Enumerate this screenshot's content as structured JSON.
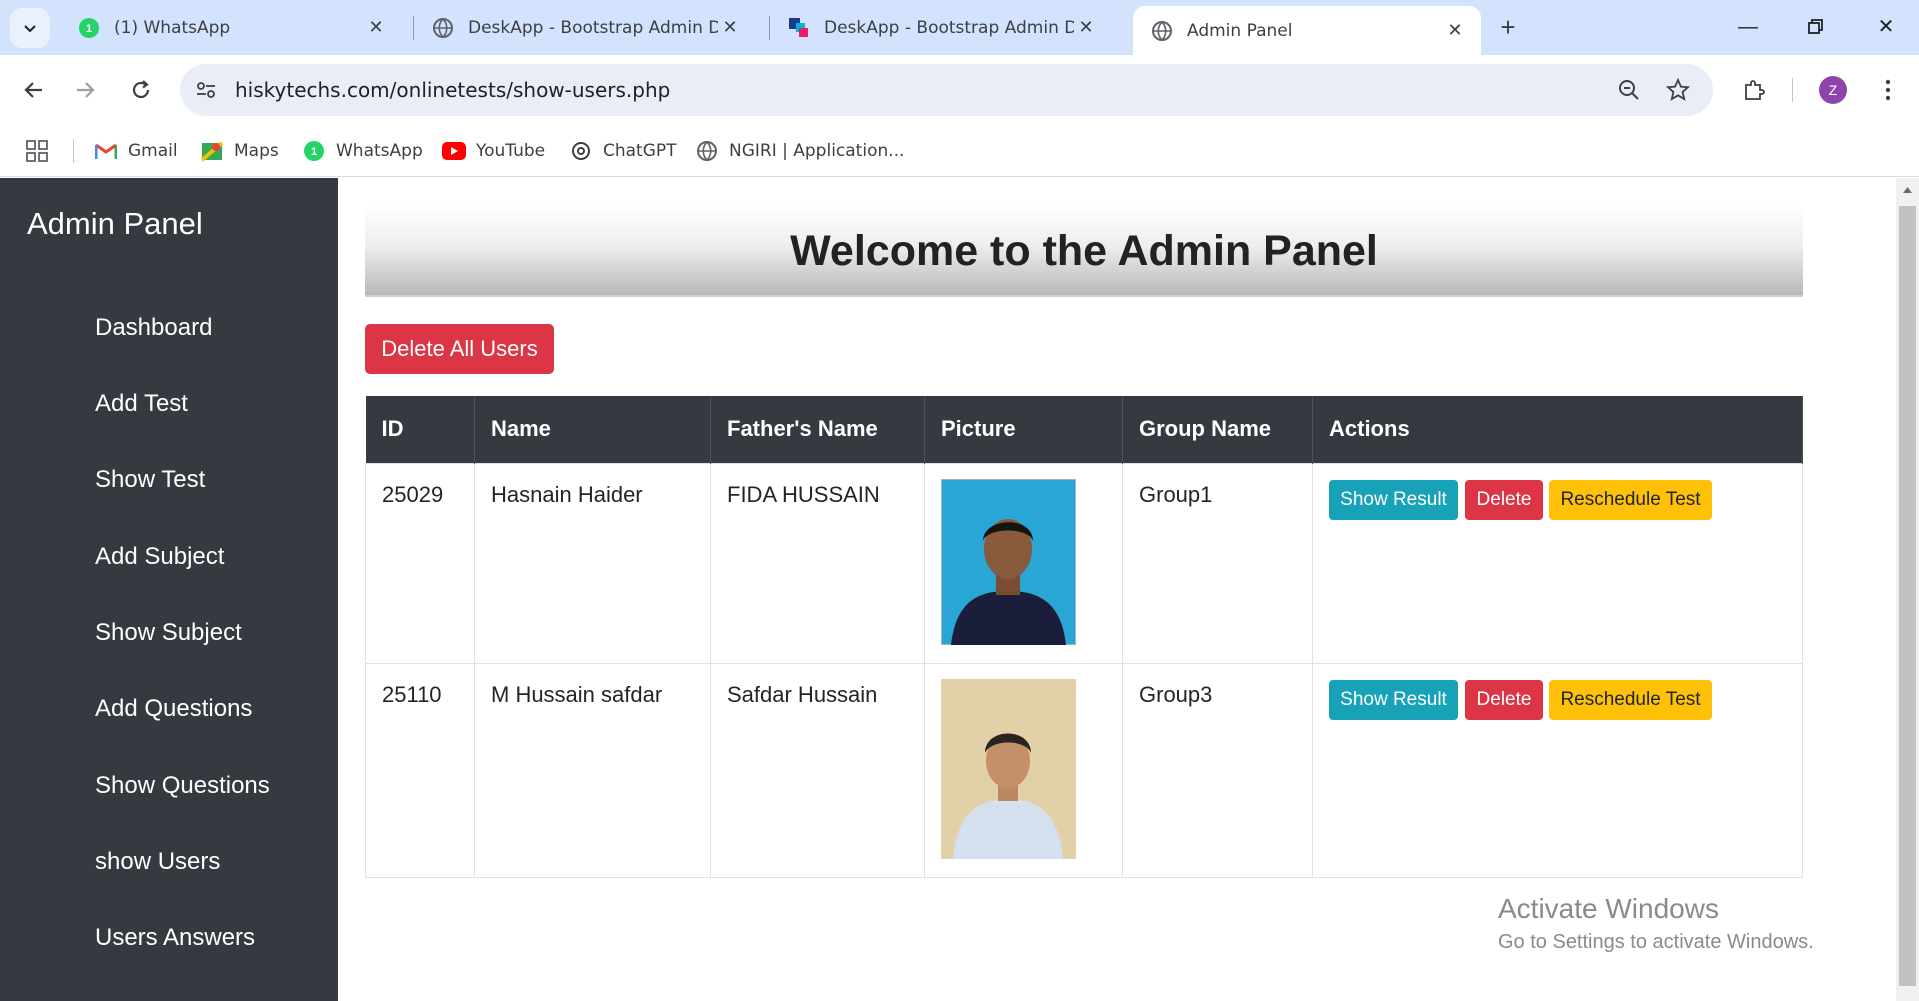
{
  "browser": {
    "tabs": [
      {
        "title": "(1) WhatsApp",
        "icon": "whatsapp-icon"
      },
      {
        "title": "DeskApp - Bootstrap Admin Da",
        "icon": "globe-icon"
      },
      {
        "title": "DeskApp - Bootstrap Admin Da",
        "icon": "deskapp-icon"
      },
      {
        "title": "Admin Panel",
        "icon": "globe-icon"
      }
    ],
    "url": "hiskytechs.com/onlinetests/show-users.php",
    "profile_initial": "Z",
    "bookmarks": [
      {
        "label": "Gmail",
        "icon": "gmail-icon"
      },
      {
        "label": "Maps",
        "icon": "maps-icon"
      },
      {
        "label": "WhatsApp",
        "icon": "whatsapp-icon"
      },
      {
        "label": "YouTube",
        "icon": "youtube-icon"
      },
      {
        "label": "ChatGPT",
        "icon": "chatgpt-icon"
      },
      {
        "label": "NGIRI | Application...",
        "icon": "globe-icon"
      }
    ]
  },
  "sidebar": {
    "title": "Admin Panel",
    "items": [
      {
        "label": "Dashboard"
      },
      {
        "label": "Add Test"
      },
      {
        "label": "Show Test"
      },
      {
        "label": "Add Subject"
      },
      {
        "label": "Show Subject"
      },
      {
        "label": "Add Questions"
      },
      {
        "label": "Show Questions"
      },
      {
        "label": "show Users"
      },
      {
        "label": "Users Answers"
      }
    ]
  },
  "main": {
    "heading": "Welcome to the Admin Panel",
    "delete_all_label": "Delete All Users",
    "table": {
      "columns": [
        "ID",
        "Name",
        "Father's Name",
        "Picture",
        "Group Name",
        "Actions"
      ],
      "rows": [
        {
          "id": "25029",
          "name": "Hasnain Haider",
          "father": "FIDA HUSSAIN",
          "group": "Group1"
        },
        {
          "id": "25110",
          "name": "M Hussain safdar",
          "father": "Safdar Hussain",
          "group": "Group3"
        }
      ],
      "actions": {
        "show_result": "Show Result",
        "delete": "Delete",
        "reschedule": "Reschedule Test"
      }
    }
  },
  "watermark": {
    "line1": "Activate Windows",
    "line2": "Go to Settings to activate Windows."
  },
  "colors": {
    "sidebar_bg": "#343a40",
    "danger": "#dc3545",
    "info": "#17a2b8",
    "warning": "#ffc107"
  }
}
